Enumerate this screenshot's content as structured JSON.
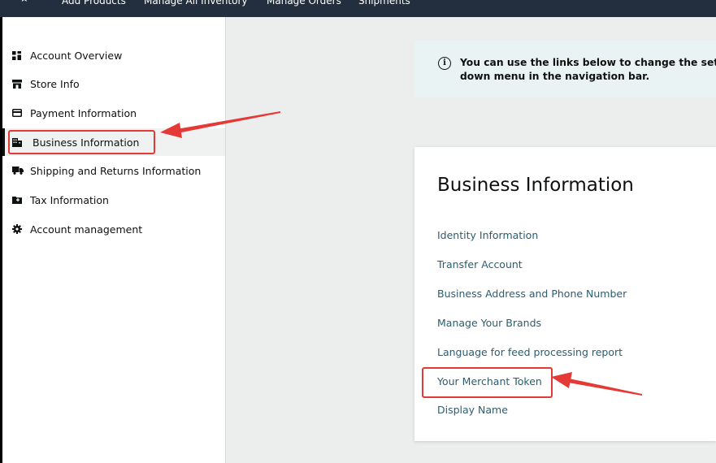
{
  "top_nav": {
    "star_icon": "star-icon",
    "items": [
      "Add Products",
      "Manage All Inventory",
      "Manage Orders",
      "Shipments"
    ]
  },
  "sidebar": {
    "items": [
      {
        "label": "Account Overview",
        "icon": "grid-icon"
      },
      {
        "label": "Store Info",
        "icon": "store-icon"
      },
      {
        "label": "Payment Information",
        "icon": "credit-card-icon"
      },
      {
        "label": "Business Information",
        "icon": "building-icon",
        "active": true
      },
      {
        "label": "Shipping and Returns Information",
        "icon": "truck-icon"
      },
      {
        "label": "Tax Information",
        "icon": "tax-folder-icon"
      },
      {
        "label": "Account management",
        "icon": "gear-icon"
      }
    ]
  },
  "banner": {
    "icon": "info-icon",
    "line1": "You can use the links below to change the sett",
    "line2": "down menu in the navigation bar."
  },
  "card": {
    "title": "Business Information",
    "links": [
      "Identity Information",
      "Transfer Account",
      "Business Address and Phone Number",
      "Manage Your Brands",
      "Language for feed processing report",
      "Your Merchant Token",
      "Display Name"
    ]
  },
  "colors": {
    "nav_bg": "#232f3e",
    "link": "#2b5d6f",
    "annotation_red": "#e53935",
    "banner_bg": "#e9f3f3",
    "page_bg": "#eceeee"
  }
}
